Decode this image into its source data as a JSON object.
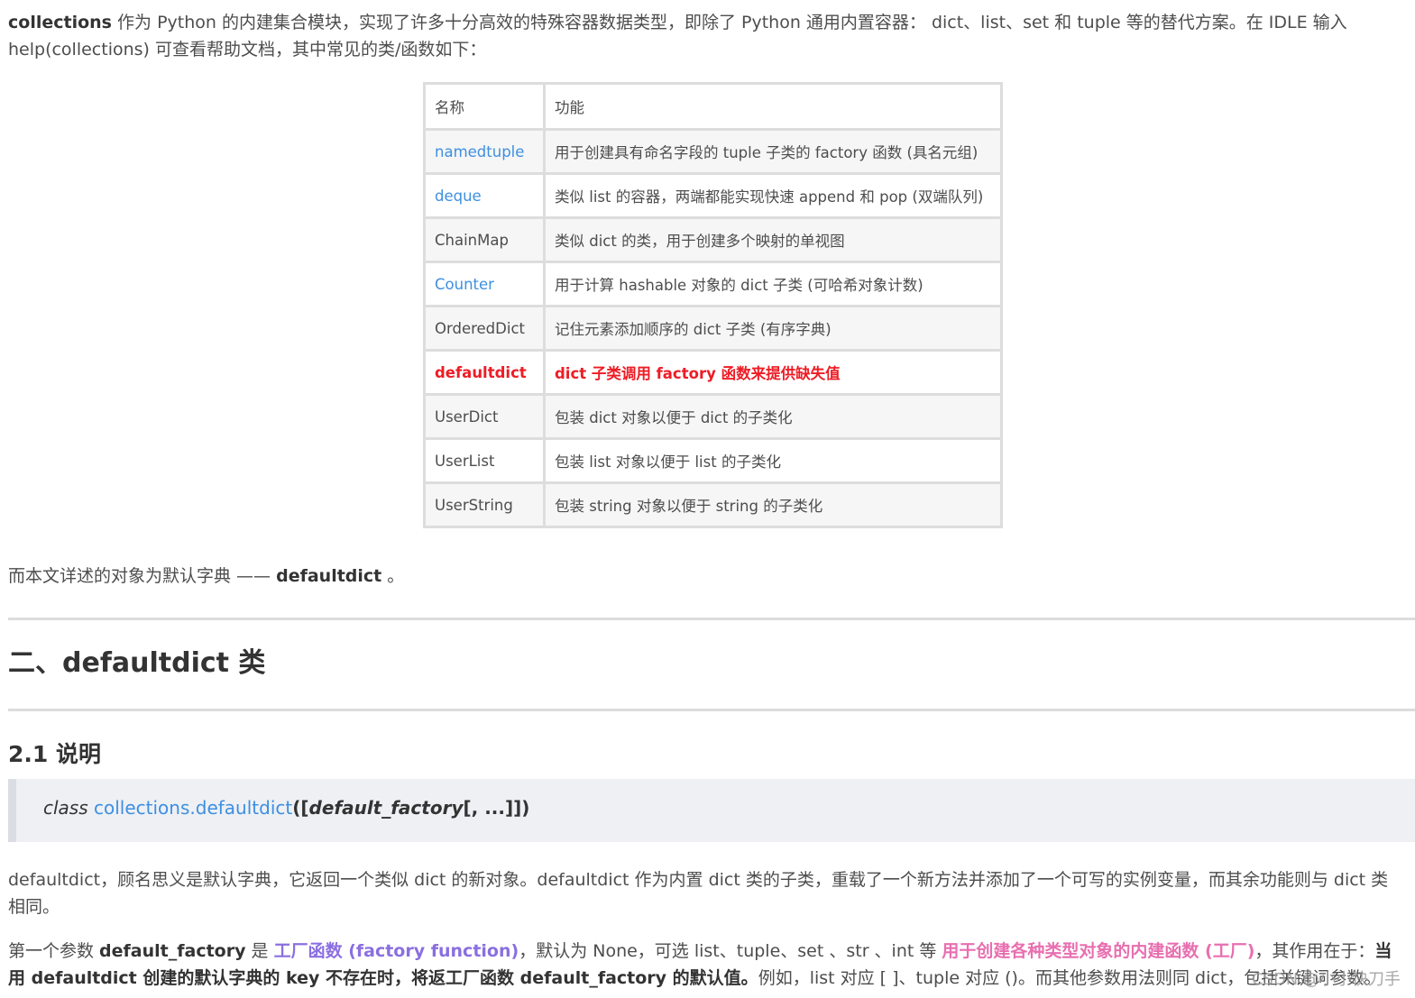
{
  "intro": {
    "bold_name": "collections",
    "text": " 作为 Python 的内建集合模块，实现了许多十分高效的特殊容器数据类型，即除了 Python 通用内置容器： dict、list、set 和 tuple 等的替代方案。在 IDLE 输入 help(collections) 可查看帮助文档，其中常见的类/函数如下："
  },
  "table": {
    "headers": [
      "名称",
      "功能"
    ],
    "rows": [
      {
        "name": "namedtuple",
        "desc": "用于创建具有命名字段的 tuple 子类的 factory 函数 (具名元组)"
      },
      {
        "name": "deque",
        "desc": "类似 list 的容器，两端都能实现快速 append 和 pop (双端队列)"
      },
      {
        "name": "ChainMap",
        "desc": "类似 dict 的类，用于创建多个映射的单视图"
      },
      {
        "name": "Counter",
        "desc": "用于计算 hashable 对象的 dict 子类 (可哈希对象计数)"
      },
      {
        "name": "OrderedDict",
        "desc": "记住元素添加顺序的 dict 子类 (有序字典)"
      },
      {
        "name": "defaultdict",
        "desc": "dict 子类调用 factory 函数来提供缺失值"
      },
      {
        "name": "UserDict",
        "desc": "包装 dict 对象以便于 dict 的子类化"
      },
      {
        "name": "UserList",
        "desc": "包装 list 对象以便于 list 的子类化"
      },
      {
        "name": "UserString",
        "desc": "包装 string 对象以便于 string 的子类化"
      }
    ]
  },
  "summary": {
    "text": "而本文详述的对象为默认字典 —— ",
    "bold": "defaultdict",
    "end": " 。"
  },
  "heading2": "二、defaultdict 类",
  "heading3": "2.1 说明",
  "signature": {
    "class_kw": "class",
    "name": "collections.defaultdict",
    "open": "([",
    "param": "default_factory",
    "rest": "[, ...]])"
  },
  "desc": "defaultdict，顾名思义是默认字典，它返回一个类似 dict 的新对象。defaultdict 作为内置 dict 类的子类，重载了一个新方法并添加了一个可写的实例变量，而其余功能则与 dict 类相同。",
  "param_para": {
    "t1": "第一个参数 ",
    "b1": "default_factory",
    "t2": " 是 ",
    "purple": "工厂函数 (factory function)",
    "t3": "，默认为 None，可选 list、tuple、set 、str 、int 等 ",
    "pink": "用于创建各种类型对象的内建函数 (工厂)",
    "t4": "，其作用在于：",
    "b2": "当用 defaultdict 创建的默认字典的 key 不存在时，将返工厂函数 default_factory 的默认值。",
    "t5": "例如，list 对应 [ ]、tuple 对应 ()。而其他参数用法则同 dict，包括关键词参数。"
  },
  "watermark": "CSDN @小小快刀手",
  "colors": {
    "link": "#3e8fe0",
    "highlight": "#ee1c25",
    "purple": "#8a6fe0",
    "pink": "#e86fb0"
  }
}
